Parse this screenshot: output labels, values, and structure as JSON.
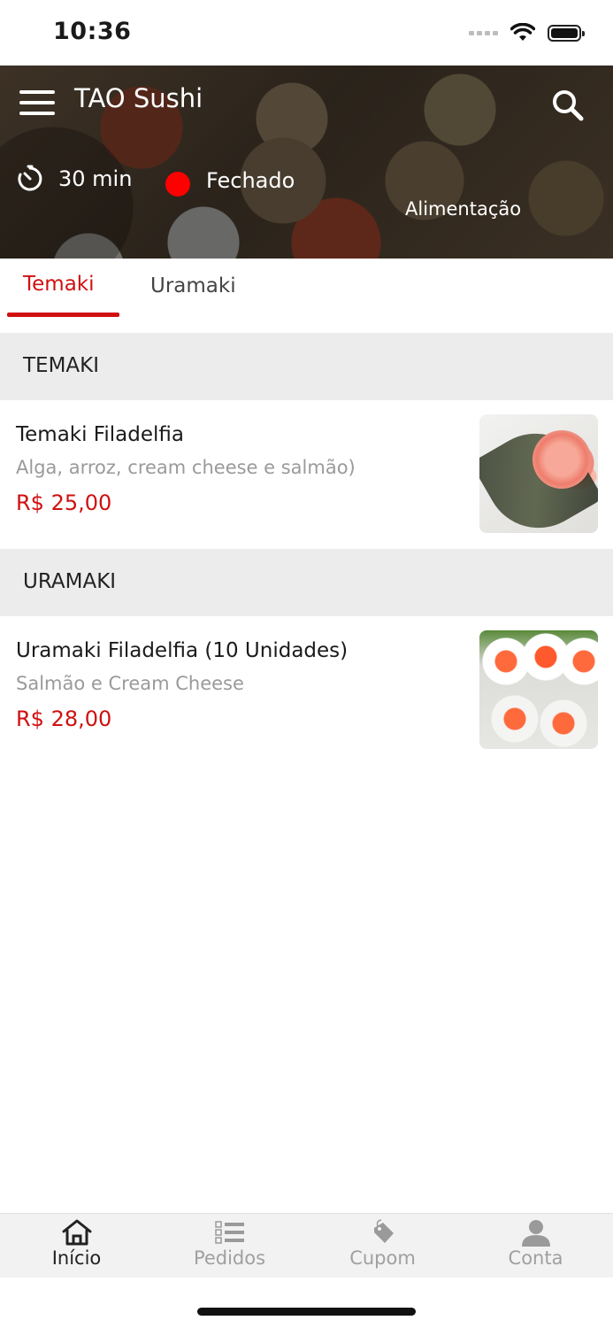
{
  "status_bar": {
    "time": "10:36"
  },
  "header": {
    "store_name": "TAO Sushi",
    "delivery_time": "30 min",
    "open_status": "Fechado",
    "category": "Alimentação",
    "status_color": "#ff0000"
  },
  "tabs": [
    {
      "label": "Temaki",
      "active": true
    },
    {
      "label": "Uramaki",
      "active": false
    }
  ],
  "sections": [
    {
      "title": "TEMAKI",
      "products": [
        {
          "name": "Temaki Filadelfia",
          "description": "Alga, arroz, cream cheese e salmão)",
          "price": "R$ 25,00",
          "image_icon": "temaki-photo"
        }
      ]
    },
    {
      "title": "URAMAKI",
      "products": [
        {
          "name": "Uramaki Filadelfia (10 Unidades)",
          "description": "Salmão e Cream Cheese",
          "price": "R$ 28,00",
          "image_icon": "uramaki-photo"
        }
      ]
    }
  ],
  "bottom_nav": [
    {
      "label": "Início",
      "icon": "home-icon",
      "active": true
    },
    {
      "label": "Pedidos",
      "icon": "list-icon",
      "active": false
    },
    {
      "label": "Cupom",
      "icon": "tag-icon",
      "active": false
    },
    {
      "label": "Conta",
      "icon": "user-icon",
      "active": false
    }
  ],
  "colors": {
    "accent": "#d01010",
    "section_bg": "#ececec",
    "muted_text": "#9a9a9a"
  }
}
